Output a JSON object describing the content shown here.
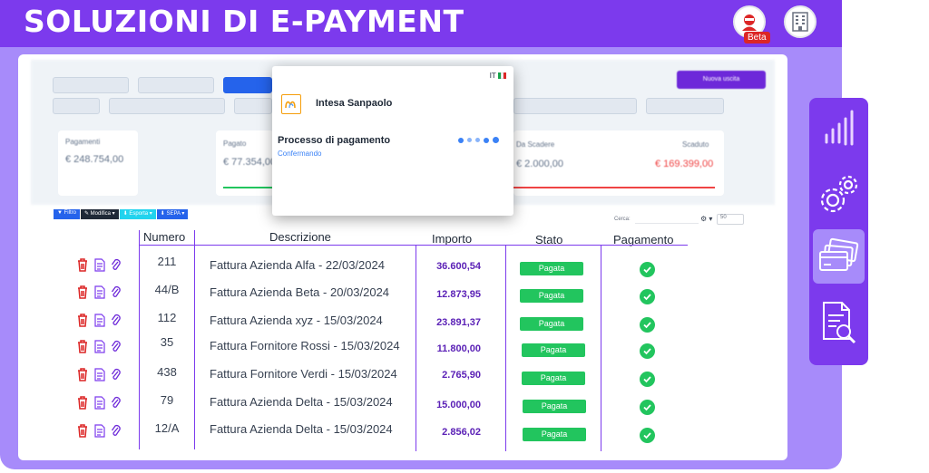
{
  "header": {
    "title": "SOLUZIONI DI E-PAYMENT",
    "beta_label": "Beta"
  },
  "modal": {
    "lang": "IT",
    "bank_name": "Intesa Sanpaolo",
    "process_title": "Processo di pagamento",
    "process_status": "Confermando"
  },
  "toolbar": {
    "filter": "Filtro",
    "edit": "Modifica",
    "export": "Esporta",
    "sepa": "SEPA",
    "search_label": "Cerca:",
    "per_page": "50"
  },
  "background_dashboard": {
    "button_new": "Nuova uscita",
    "card_pagamenti_label": "Pagamenti",
    "card_pagamenti_value": "€ 248.754,00",
    "card_pagato_label": "Pagato",
    "card_pagato_value": "€ 77.354,00",
    "card_scadere_label": "Da Scadere",
    "card_scadere_value": "€ 2.000,00",
    "card_scaduto_label": "Scaduto",
    "card_scaduto_value": "€ 169.399,00"
  },
  "table": {
    "headers": {
      "numero": "Numero",
      "descrizione": "Descrizione",
      "importo": "Importo",
      "stato": "Stato",
      "pagamento": "Pagamento"
    },
    "rows": [
      {
        "numero": "211",
        "descrizione": "Fattura Azienda Alfa - 22/03/2024",
        "importo": "36.600,54",
        "stato": "Pagata"
      },
      {
        "numero": "44/B",
        "descrizione": "Fattura Azienda Beta - 20/03/2024",
        "importo": "12.873,95",
        "stato": "Pagata"
      },
      {
        "numero": "112",
        "descrizione": "Fattura Azienda xyz - 15/03/2024",
        "importo": "23.891,37",
        "stato": "Pagata"
      },
      {
        "numero": "35",
        "descrizione": "Fattura Fornitore Rossi - 15/03/2024",
        "importo": "11.800,00",
        "stato": "Pagata"
      },
      {
        "numero": "438",
        "descrizione": "Fattura Fornitore Verdi - 15/03/2024",
        "importo": "2.765,90",
        "stato": "Pagata"
      },
      {
        "numero": "79",
        "descrizione": "Fattura Azienda Delta - 15/03/2024",
        "importo": "15.000,00",
        "stato": "Pagata"
      },
      {
        "numero": "12/A",
        "descrizione": "Fattura Azienda Delta - 15/03/2024",
        "importo": "2.856,02",
        "stato": "Pagata"
      }
    ]
  },
  "sidebar": {
    "items": [
      "chart-icon",
      "gears-icon",
      "cards-icon",
      "report-search-icon"
    ]
  },
  "colors": {
    "primary": "#7c3aed",
    "light": "#a78bfa",
    "success": "#22c55e",
    "danger": "#dc2626",
    "amount": "#5b21b6"
  }
}
